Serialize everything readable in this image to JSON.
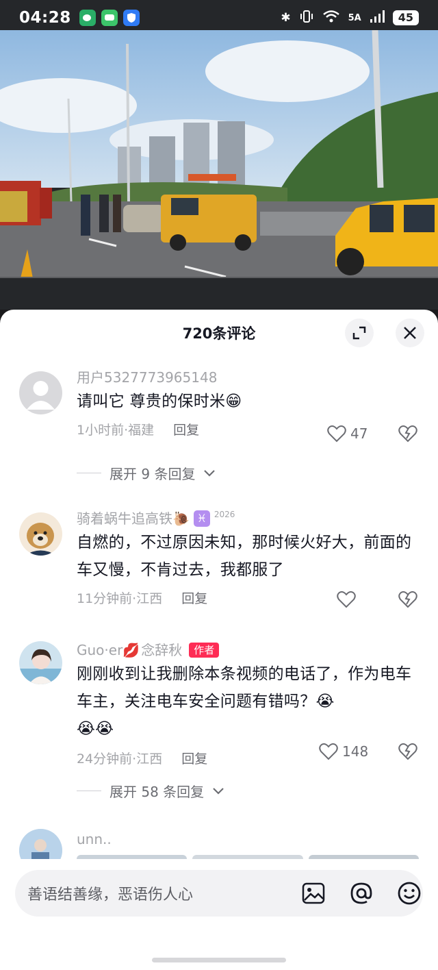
{
  "status_bar": {
    "time": "04:28",
    "network": "5A",
    "battery": "45"
  },
  "comments_sheet": {
    "title": "720条评论",
    "comments": [
      {
        "username": "用户5327773965148",
        "text": "请叫它 尊贵的保时米😁",
        "time_location": "1小时前·福建",
        "reply_label": "回复",
        "likes": "47",
        "expand_label": "展开 9 条回复"
      },
      {
        "username": "骑着蜗牛追高铁",
        "username_emoji": "🐌",
        "zodiac_icon": "♓",
        "zodiac_year": "2026",
        "text": "自燃的，不过原因未知，那时候火好大，前面的车又慢，不肯过去，我都服了",
        "time_location": "11分钟前·江西",
        "reply_label": "回复",
        "likes": ""
      },
      {
        "username": "Guo·er",
        "username_emoji": "💋",
        "username_suffix": "念辞秋",
        "author_badge": "作者",
        "text": "刚刚收到让我删除本条视频的电话了，作为电车车主，关注电车安全问题有错吗？😭",
        "text_line2": "😭😭",
        "time_location": "24分钟前·江西",
        "reply_label": "回复",
        "likes": "148",
        "expand_label": "展开 58 条回复"
      },
      {
        "username": "unn.."
      }
    ]
  },
  "input_bar": {
    "placeholder": "善语结善缘，恶语伤人心"
  },
  "icons": [
    "expand-icon",
    "close-icon",
    "heart-icon",
    "dislike-icon",
    "chevron-down-icon",
    "image-icon",
    "at-icon",
    "emoji-icon"
  ],
  "colors": {
    "accent": "#fe2c55",
    "text": "#161823",
    "muted": "#a3a4a8"
  }
}
